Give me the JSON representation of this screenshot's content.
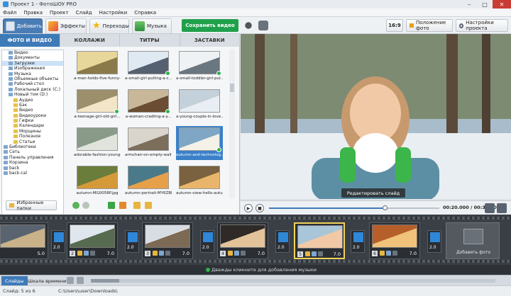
{
  "window": {
    "title": "Проект 1 - ФотоШОУ PRO"
  },
  "menu": [
    "Файл",
    "Правка",
    "Проект",
    "Слайд",
    "Настройки",
    "Справка"
  ],
  "toolbar": {
    "tabs": [
      {
        "label": "Добавить",
        "active": true
      },
      {
        "label": "Эффекты"
      },
      {
        "label": "Переходы"
      },
      {
        "label": "Музыка"
      }
    ],
    "save_label": "Сохранить видео",
    "aspect_label": "16:9",
    "photo_pos_label": "Положение фото",
    "project_settings_label": "Настройки проекта"
  },
  "subtabs": [
    "ФОТО И ВИДЕО",
    "КОЛЛАЖИ",
    "ТИТРЫ",
    "ЗАСТАВКИ"
  ],
  "tree": [
    {
      "label": "Видео",
      "indent": 1
    },
    {
      "label": "Документы",
      "indent": 1
    },
    {
      "label": "Загрузки",
      "indent": 1,
      "selected": true
    },
    {
      "label": "Изображения",
      "indent": 1
    },
    {
      "label": "Музыка",
      "indent": 1
    },
    {
      "label": "Объемные объекты",
      "indent": 1
    },
    {
      "label": "Рабочий стол",
      "indent": 1
    },
    {
      "label": "Локальный диск (C:)",
      "indent": 1
    },
    {
      "label": "Новый том (D:)",
      "indent": 1
    },
    {
      "label": "Аудио",
      "indent": 2
    },
    {
      "label": "Бэк",
      "indent": 2
    },
    {
      "label": "Видео",
      "indent": 2
    },
    {
      "label": "Видеоуроки",
      "indent": 2
    },
    {
      "label": "Гифки",
      "indent": 2
    },
    {
      "label": "Календари",
      "indent": 2
    },
    {
      "label": "Морщины",
      "indent": 2
    },
    {
      "label": "Полезное",
      "indent": 2
    },
    {
      "label": "Статьи",
      "indent": 2
    },
    {
      "label": "Библиотеки",
      "indent": 0
    },
    {
      "label": "Сеть",
      "indent": 0
    },
    {
      "label": "Панель управления",
      "indent": 0
    },
    {
      "label": "Корзина",
      "indent": 0
    },
    {
      "label": "back",
      "indent": 0
    },
    {
      "label": "back-cal",
      "indent": 0
    }
  ],
  "favorites_label": "Избранные папки",
  "files": [
    {
      "label": "a-man-holds-five-funny-p...",
      "checked": false
    },
    {
      "label": "a-small-girl-pulling-a-c...",
      "checked": true
    },
    {
      "label": "a-small-toddler-girl-pul...",
      "checked": true
    },
    {
      "label": "a-teenage-girl-old-girl...",
      "checked": true
    },
    {
      "label": "a-woman-cradling-a-y...",
      "checked": true
    },
    {
      "label": "a-young-couple-in-love...",
      "checked": false
    },
    {
      "label": "adorable-fashion-young-p...",
      "checked": false
    },
    {
      "label": "armchair-on-empty-wall-f...",
      "checked": false
    },
    {
      "label": "autumn-and-technolog...",
      "checked": true,
      "selected": true
    },
    {
      "label": "autumn-MG0058P.jpg",
      "checked": false
    },
    {
      "label": "autumn-portrait-MY6ZBF...",
      "checked": false
    },
    {
      "label": "autumn-view-hello-autu...",
      "checked": false
    }
  ],
  "preview": {
    "edit_slide_label": "Редактировать слайд"
  },
  "player": {
    "time": "00:20.000 / 00:30.000",
    "progress": 0.68
  },
  "slides": [
    {
      "num": "",
      "duration": "5.0"
    },
    {
      "num": "2",
      "duration": "7.0"
    },
    {
      "num": "3",
      "duration": "7.0"
    },
    {
      "num": "4",
      "duration": "7.0"
    },
    {
      "num": "5",
      "duration": "7.0",
      "selected": true
    },
    {
      "num": "6",
      "duration": "7.0"
    }
  ],
  "transitions": [
    "2.0",
    "2.0",
    "2.0",
    "2.0",
    "2.0",
    "2.0"
  ],
  "add_photo_label": "Добавить фото",
  "music_hint": "Дважды кликните для добавления музыки",
  "bottom_tabs": [
    {
      "label": "Слайды",
      "active": true
    },
    {
      "label": "Шкала времени"
    }
  ],
  "status": {
    "slide": "Слайд: 5 из 6",
    "path": "C:\\Users\\user\\Downloads\\"
  },
  "colors": {
    "accent": "#3e7ab8",
    "save_green": "#1fa04a",
    "timeline_bg": "#3a3f45"
  }
}
